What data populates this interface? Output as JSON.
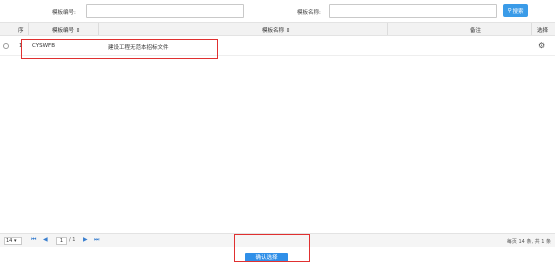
{
  "search": {
    "code_label": "模板编号:",
    "code_value": "",
    "name_label": "模板名称:",
    "name_value": "",
    "button_label": "搜索",
    "button_icon": "search-icon"
  },
  "table": {
    "columns": [
      "序",
      "模板编号",
      "模板名称",
      "备注",
      "选择"
    ],
    "rows": [
      {
        "index": "1",
        "code": "CYSWFB",
        "name": "建设工程无范本招标文件",
        "remark": "",
        "action_icon": "gear-icon"
      }
    ]
  },
  "pager": {
    "page_size": "14",
    "current_page": "1",
    "total_pages_text": "/ 1",
    "summary": "每页 14 条, 共 1 条"
  },
  "footer": {
    "confirm_label": "确认选择"
  },
  "colors": {
    "accent": "#3a9be8",
    "highlight": "#e03030"
  }
}
